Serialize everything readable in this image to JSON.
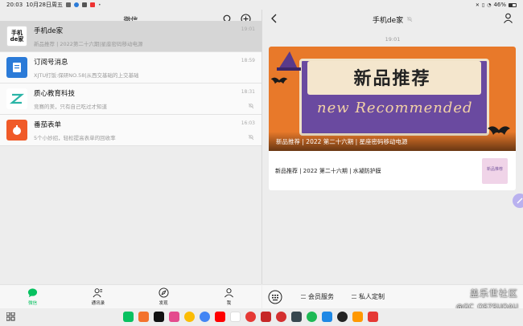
{
  "status_bar": {
    "time": "20:03",
    "date": "10月28日周五",
    "battery": "46%"
  },
  "left": {
    "title": "微信",
    "chats": [
      {
        "name": "手机de家",
        "preview": "新品推荐 | 2022第二十六期|星座密码移动电源",
        "time": "19:01",
        "avatar_text": "手机\nde家",
        "avatar_color": "#ffffff",
        "muted": false
      },
      {
        "name": "订阅号消息",
        "preview": "XJTU打饭:保研NO.58|从西交基础的上交基础",
        "time": "18:59",
        "avatar_color": "#2b7bd8",
        "muted": false
      },
      {
        "name": "质心教育科技",
        "preview": "竞赛的美，只有自己吃过才知道",
        "time": "18:31",
        "avatar_color": "#ffffff",
        "muted": true
      },
      {
        "name": "番茄表单",
        "preview": "5个小妙招，轻松提高表单的回收率",
        "time": "16:03",
        "avatar_color": "#f05a28",
        "muted": true
      }
    ]
  },
  "right": {
    "title": "手机de家",
    "message_time": "19:01",
    "article": {
      "cover_title": "新品推荐",
      "cover_eng": "new Recommended",
      "overlay_title": "新品推荐 | 2022 第二十六期 | 星座密码移动电源",
      "sub_title": "新品推荐 | 2022 第二十六期 | 水凝防护膜",
      "thumb_text": "新品推荐"
    },
    "menu": [
      "会员服务",
      "私人定制"
    ]
  },
  "tabs": [
    {
      "label": "微信",
      "icon": "chat-icon",
      "active": true
    },
    {
      "label": "通讯录",
      "icon": "contacts-icon",
      "active": false
    },
    {
      "label": "发现",
      "icon": "compass-icon",
      "active": false
    },
    {
      "label": "我",
      "icon": "person-icon",
      "active": false
    }
  ],
  "watermark": {
    "site": "盖乐世社区",
    "user": "@GC_QS7SUQAU"
  },
  "dock_apps": [
    "wechat",
    "browser",
    "tiktok",
    "gallery",
    "photos",
    "chrome",
    "youtube",
    "gmail",
    "music",
    "youtube-music",
    "camera",
    "clock",
    "spotify",
    "files",
    "qq",
    "game",
    "store"
  ]
}
